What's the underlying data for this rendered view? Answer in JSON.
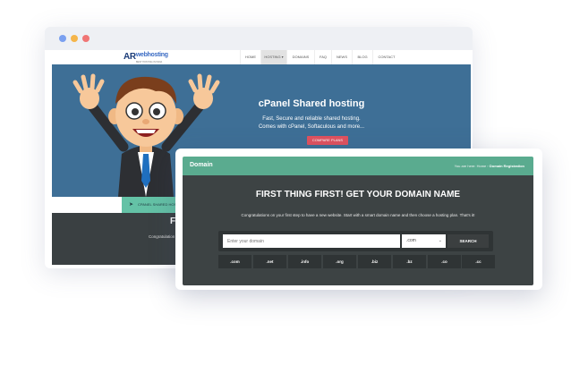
{
  "back_window": {
    "logo": {
      "main": "AR",
      "sub": "webhosting",
      "tagline": "BEST HOSTING IN INDIA"
    },
    "nav": [
      {
        "label": "HOME"
      },
      {
        "label": "HOSTING ▾"
      },
      {
        "label": "DOMAINS"
      },
      {
        "label": "FAQ"
      },
      {
        "label": "NEWS"
      },
      {
        "label": "BLOG"
      },
      {
        "label": "CONTACT"
      }
    ],
    "hero": {
      "title": "cPanel Shared hosting",
      "subtitle_line1": "Fast, Secure and reliable shared hosting.",
      "subtitle_line2": "Comes with cPanel, Softaculous and more...",
      "cta": "COMPARE PLANS"
    },
    "strip_label": "CPANEL SHARED HOSTI",
    "section_initial": "F",
    "section_text": "Congratulation"
  },
  "front_window": {
    "header_title": "Domain",
    "breadcrumb": {
      "prefix": "You are here:",
      "home": "Home",
      "sep": "›",
      "current": "Domain Registration"
    },
    "heading": "FIRST THING FIRST! GET YOUR DOMAIN NAME",
    "intro": "Congratulations on your first step to have a new website. Start with a smart domain name and then choose a hosting plan. That's it!",
    "search": {
      "placeholder": "Enter your domain",
      "tld_selected": ".com",
      "button": "SEARCH"
    },
    "tlds": [
      ".com",
      ".net",
      ".info",
      ".org",
      ".biz",
      ".bz",
      ".co",
      ".cc"
    ]
  },
  "colors": {
    "dot_red": "#f07575",
    "dot_yellow": "#f5b54a",
    "dot_blue": "#7aa0f0",
    "hero_bg": "#3e6f96",
    "accent_green": "#5aab8f",
    "cta_red": "#e0525f",
    "dark_panel": "#3d4344"
  }
}
